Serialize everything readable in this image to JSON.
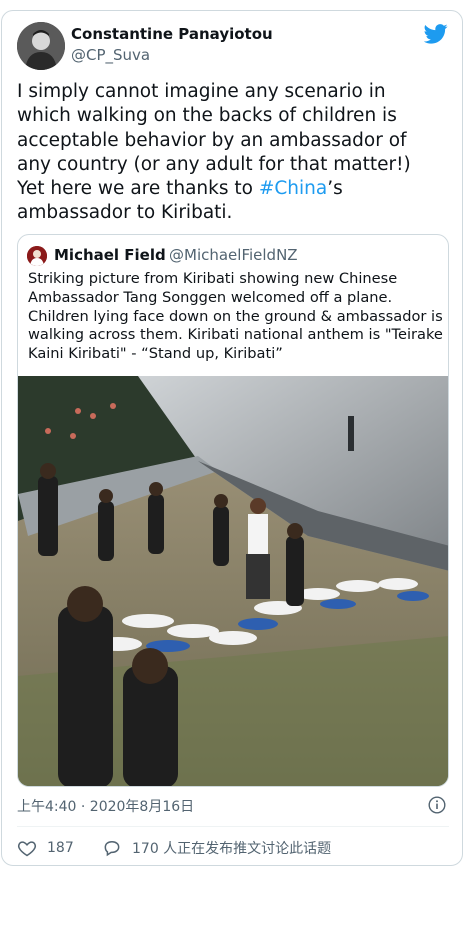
{
  "tweet": {
    "author_name": "Constantine Panayiotou",
    "author_handle": "@CP_Suva",
    "text_before": "I simply cannot imagine any scenario in which walking on the backs of children is acceptable behavior by an ambassador of any country (or any adult for that matter!) Yet here we are thanks to ",
    "hashtag": "#China",
    "text_after": "’s ambassador to Kiribati.",
    "timestamp": "上午4:40 · 2020年8月16日",
    "likes": "187",
    "replies_label": "170 人正在发布推文讨论此话题"
  },
  "quoted": {
    "author_name": "Michael Field",
    "author_handle": "@MichaelFieldNZ",
    "text": "Striking picture from Kiribati showing new Chinese Ambassador Tang Songgen welcomed off a plane. Children lying face down on the ground & ambassador is walking across them. Kiribati national anthem is \"Teirake Kaini Kiribati\" - “Stand up, Kiribati”"
  },
  "icons": {
    "brand": "twitter-bird-icon",
    "info": "info-icon",
    "like": "heart-icon",
    "reply": "speech-bubble-icon"
  },
  "colors": {
    "link": "#1d9bf0",
    "secondary_text": "#536471",
    "border": "#cfd9de"
  }
}
